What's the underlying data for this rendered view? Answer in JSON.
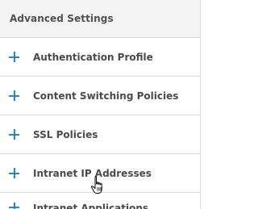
{
  "header": {
    "title": "Advanced Settings"
  },
  "items": [
    {
      "label": "Authentication Profile"
    },
    {
      "label": "Content Switching Policies"
    },
    {
      "label": "SSL Policies"
    },
    {
      "label": "Intranet IP Addresses"
    },
    {
      "label": "Intranet Applications"
    }
  ],
  "colors": {
    "accent": "#2a86c9",
    "header_bg": "#f4f4f4",
    "text": "#4a4a4a"
  },
  "icons": {
    "expand": "plus-icon",
    "pointer": "hand-pointer-cursor-icon"
  }
}
